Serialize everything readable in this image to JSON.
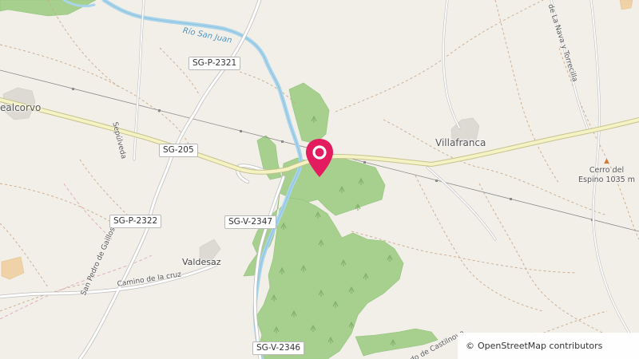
{
  "map": {
    "marker": {
      "color": "#e31c5f",
      "icon": "map-pin-icon"
    },
    "places": {
      "villafranca": "Villafranca",
      "valdesaz": "Valdesaz",
      "realcorvo": "ealcorvo"
    },
    "roads": {
      "sg205": "SG-205",
      "sgp2321": "SG-P-2321",
      "sgp2322": "SG-P-2322",
      "sgv2347": "SG-V-2347",
      "sgv2346": "SG-V-2346"
    },
    "streets": {
      "sepulveda": "Sepúlveda",
      "camino_cruz": "Camino de la cruz",
      "san_pedro": "San Pedro de Gaillos",
      "nava": "de La Nava y Torrecilla",
      "castilnovo": "do de Castilnovo"
    },
    "river": "Río San Juan",
    "peak": {
      "name_line1": "Cerro del",
      "name_line2": "Espino",
      "elevation": "1035 m"
    },
    "colors": {
      "forest": "#a7d08e",
      "river": "#a9d4eb",
      "road": "#f5f3c4",
      "background": "#f2efe9"
    }
  },
  "attribution": {
    "copyright": "©",
    "text": "OpenStreetMap contributors"
  }
}
